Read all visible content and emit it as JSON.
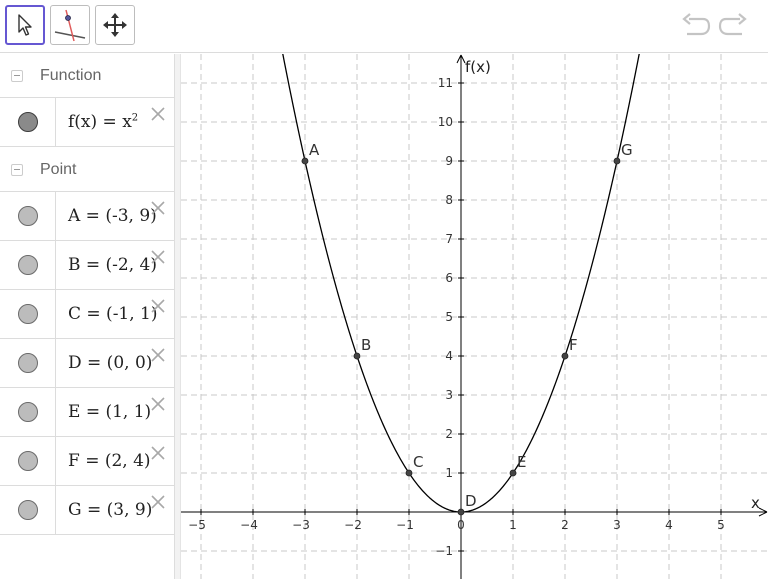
{
  "toolbar": {
    "tools": [
      {
        "icon": "arrow-pointer-icon",
        "active": true
      },
      {
        "icon": "perpendicular-line-icon",
        "active": false
      },
      {
        "icon": "move-graphics-view-icon",
        "active": false
      }
    ],
    "undo_icon": "undo-icon",
    "redo_icon": "redo-icon"
  },
  "algebra": {
    "groups": [
      {
        "label": "Function",
        "items": [
          {
            "name": "f",
            "text": "f(x) = x",
            "superscript": "2",
            "icon": "visibility-marble-icon"
          }
        ]
      },
      {
        "label": "Point",
        "items": [
          {
            "name": "A",
            "text": "A = (-3, 9)",
            "icon": "visibility-marble-icon"
          },
          {
            "name": "B",
            "text": "B = (-2, 4)",
            "icon": "visibility-marble-icon"
          },
          {
            "name": "C",
            "text": "C = (-1, 1)",
            "icon": "visibility-marble-icon"
          },
          {
            "name": "D",
            "text": "D = (0, 0)",
            "icon": "visibility-marble-icon"
          },
          {
            "name": "E",
            "text": "E = (1, 1)",
            "icon": "visibility-marble-icon"
          },
          {
            "name": "F",
            "text": "F = (2, 4)",
            "icon": "visibility-marble-icon"
          },
          {
            "name": "G",
            "text": "G = (3, 9)",
            "icon": "visibility-marble-icon"
          }
        ]
      }
    ],
    "close_icon": "close-icon"
  },
  "graphics": {
    "x_axis_label": "x",
    "y_axis_label": "f(x)",
    "x_ticks": [
      -5,
      -4,
      -3,
      -2,
      -1,
      0,
      1,
      2,
      3,
      4,
      5
    ],
    "y_ticks": [
      -1,
      1,
      2,
      3,
      4,
      5,
      6,
      7,
      8,
      9,
      10,
      11
    ],
    "x_range": [
      -5.3,
      5.7
    ],
    "y_range": [
      -1.2,
      11.5
    ],
    "grid": "dashed",
    "function": {
      "name": "f",
      "expression": "x^2"
    },
    "points": [
      {
        "label": "A",
        "x": -3,
        "y": 9
      },
      {
        "label": "B",
        "x": -2,
        "y": 4
      },
      {
        "label": "C",
        "x": -1,
        "y": 1
      },
      {
        "label": "D",
        "x": 0,
        "y": 0
      },
      {
        "label": "E",
        "x": 1,
        "y": 1
      },
      {
        "label": "F",
        "x": 2,
        "y": 4
      },
      {
        "label": "G",
        "x": 3,
        "y": 9
      }
    ],
    "colors": {
      "curve": "#000000",
      "grid": "#c8c8c8",
      "point": "#444444",
      "axis": "#000000"
    }
  }
}
